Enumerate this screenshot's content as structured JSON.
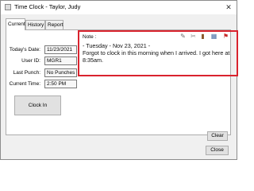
{
  "window": {
    "title": "Time Clock - Taylor, Judy",
    "close_glyph": "✕"
  },
  "tabs": [
    {
      "label": "Current",
      "active": true
    },
    {
      "label": "History",
      "active": false
    },
    {
      "label": "Report",
      "active": false
    }
  ],
  "fields": {
    "todays_date": {
      "label": "Today's Date:",
      "value": "11/23/2021"
    },
    "user_id": {
      "label": "User ID:",
      "value": "MGR1"
    },
    "last_punch": {
      "label": "Last Punch:",
      "value": "No Punches"
    },
    "current_time": {
      "label": "Current Time:",
      "value": "2:50 PM"
    }
  },
  "buttons": {
    "clock_in": "Clock In",
    "clear": "Clear",
    "close": "Close"
  },
  "note": {
    "label": "Note :",
    "text": "- Tuesday - Nov 23, 2021 -\nForgot to clock in this morning when I arrived. I got here at 8:35am.",
    "toolbar": [
      "tools-icon",
      "attach-icon",
      "document-icon",
      "calendar-icon",
      "flag-icon"
    ]
  },
  "colors": {
    "highlight": "#d9232e",
    "window_bg": "#f0f0f0"
  }
}
